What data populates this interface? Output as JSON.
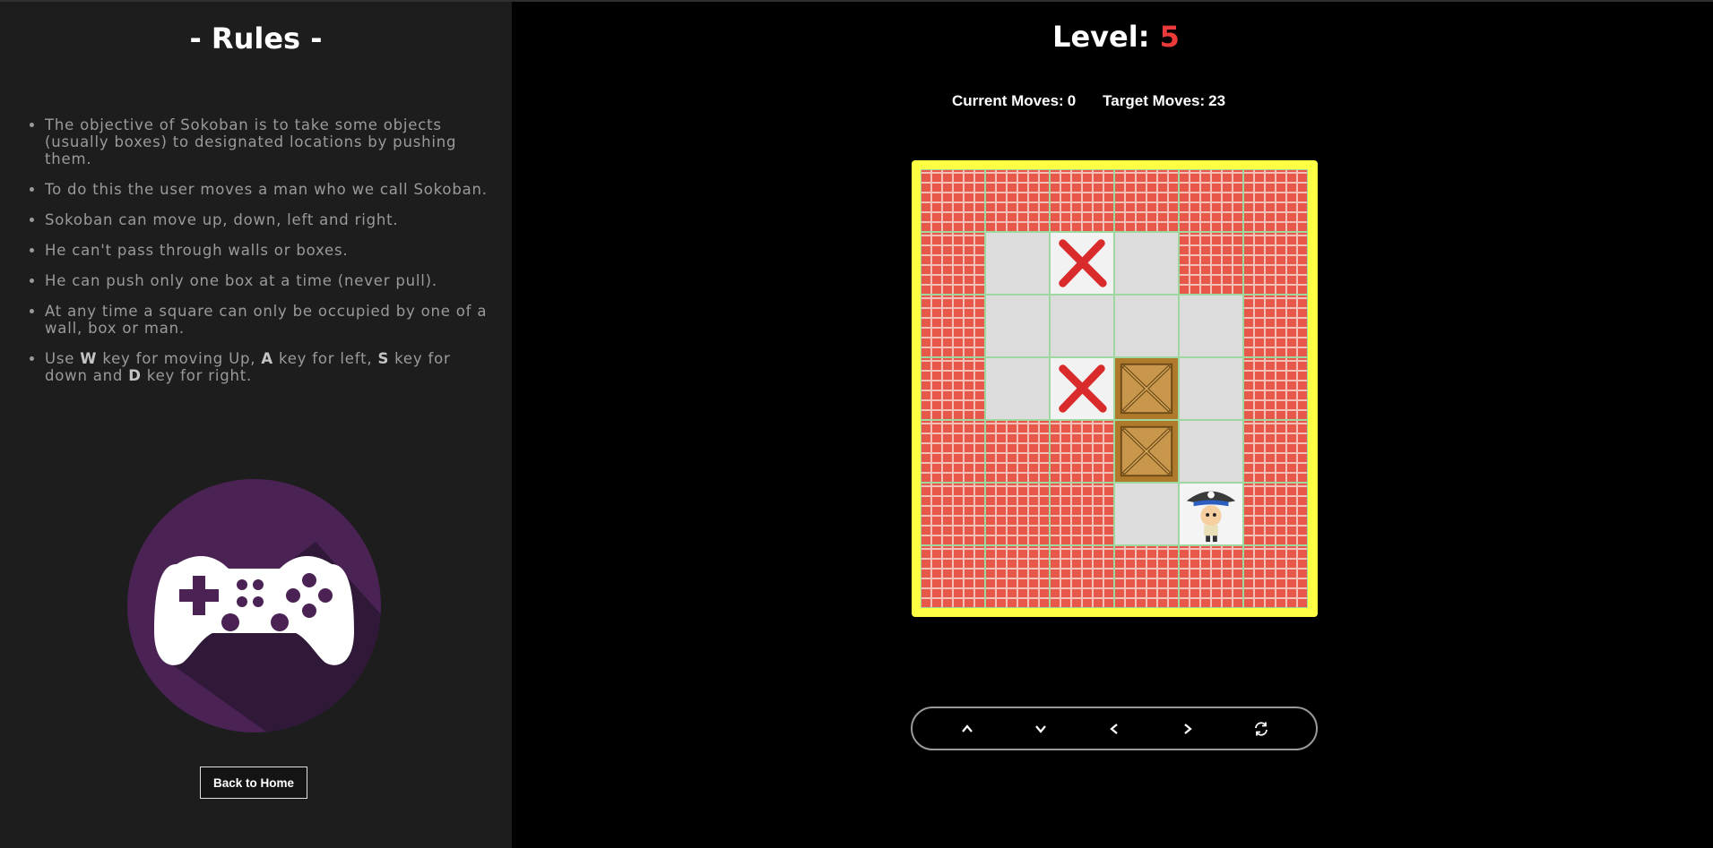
{
  "rules": {
    "title": "- Rules -",
    "items": [
      "The objective of Sokoban is to take some objects (usually boxes) to designated locations by pushing them.",
      "To do this the user moves a man who we call Sokoban.",
      "Sokoban can move up, down, left and right.",
      "He can't pass through walls or boxes.",
      "He can push only one box at a time (never pull).",
      "At any time a square can only be occupied by one of a wall, box or man."
    ],
    "keys_item": {
      "t1": "Use ",
      "k1": "W",
      "t2": " key for moving Up, ",
      "k2": "A",
      "t3": " key for left, ",
      "k3": "S",
      "t4": " key for down and ",
      "k4": "D",
      "t5": " key for right."
    },
    "back_button": "Back to Home"
  },
  "game": {
    "level_label": "Level: ",
    "level_value": "5",
    "current_moves_label": "Current Moves:",
    "current_moves_value": "0",
    "target_moves_label": "Target Moves:",
    "target_moves_value": "23",
    "grid": [
      [
        "wall",
        "wall",
        "wall",
        "wall",
        "wall",
        "wall"
      ],
      [
        "wall",
        "floor",
        "target",
        "floor",
        "wall",
        "wall"
      ],
      [
        "wall",
        "floor",
        "floor",
        "floor",
        "floor",
        "wall"
      ],
      [
        "wall",
        "floor",
        "target",
        "box",
        "floor",
        "wall"
      ],
      [
        "wall",
        "wall",
        "wall",
        "box",
        "floor",
        "wall"
      ],
      [
        "wall",
        "wall",
        "wall",
        "floor",
        "player",
        "wall"
      ],
      [
        "wall",
        "wall",
        "wall",
        "wall",
        "wall",
        "wall"
      ]
    ],
    "controls": [
      "up-icon",
      "down-icon",
      "left-icon",
      "right-icon",
      "restart-icon"
    ],
    "colors": {
      "wall": "#e8584a",
      "frame": "#ffff44",
      "target": "#d92b2b",
      "box": "#b07a2c",
      "level_accent": "#ea3a3a"
    }
  }
}
